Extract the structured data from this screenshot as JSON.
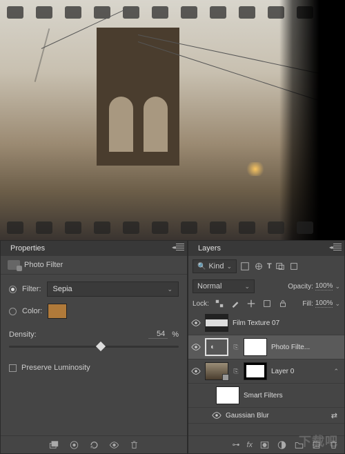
{
  "properties": {
    "panel_title": "Properties",
    "adjustment_name": "Photo Filter",
    "filter_label": "Filter:",
    "filter_value": "Sepia",
    "color_label": "Color:",
    "color_swatch": "#b07a3a",
    "density_label": "Density:",
    "density_value": "54",
    "density_unit": "%",
    "preserve_label": "Preserve Luminosity"
  },
  "layers": {
    "panel_title": "Layers",
    "kind_label": "Kind",
    "kind_search_placeholder": "",
    "blend_mode": "Normal",
    "opacity_label": "Opacity:",
    "opacity_value": "100%",
    "lock_label": "Lock:",
    "fill_label": "Fill:",
    "fill_value": "100%",
    "items": [
      {
        "name": "Film Texture 07",
        "visible": true,
        "indent": 0,
        "selected": false,
        "has_mask": false,
        "thumb": "film"
      },
      {
        "name": "Photo Filte...",
        "visible": true,
        "indent": 0,
        "selected": true,
        "has_mask": true,
        "thumb": "adjustment"
      },
      {
        "name": "Layer 0",
        "visible": true,
        "indent": 0,
        "selected": false,
        "has_mask": true,
        "thumb": "bridge",
        "has_smart": true
      },
      {
        "name": "Smart Filters",
        "visible": true,
        "indent": 1,
        "selected": false,
        "has_mask": false,
        "thumb": "mask"
      },
      {
        "name": "Gaussian Blur",
        "visible": true,
        "indent": 2,
        "selected": false,
        "has_mask": false,
        "thumb": "none"
      }
    ]
  },
  "watermark": "下载吧"
}
